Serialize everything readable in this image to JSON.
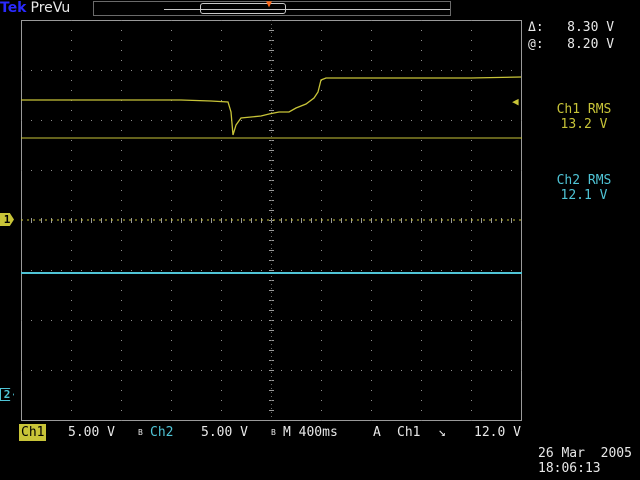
{
  "header": {
    "brand": "Tek",
    "mode": "PreVu"
  },
  "cursors": {
    "delta_label": "Δ:",
    "delta_value": "8.30 V",
    "at_label": "@:",
    "at_value": "8.20 V"
  },
  "measurements": [
    {
      "name": "Ch1 RMS",
      "value": "13.2 V"
    },
    {
      "name": "Ch2 RMS",
      "value": "12.1 V"
    }
  ],
  "channel_markers": {
    "ch1": "1",
    "ch2": "2"
  },
  "status": {
    "ch1_label": "Ch1",
    "ch1_scale": "5.00 V",
    "ch2_label": "Ch2",
    "ch2_scale": "5.00 V",
    "bw_label": "B",
    "timebase": "M 400ms",
    "trigger_prefix": "A",
    "trigger_source": "Ch1",
    "trigger_slope": "↘",
    "trigger_level": "12.0 V"
  },
  "datetime": {
    "date": "26 Mar  2005",
    "time": "18:06:13"
  },
  "colors": {
    "ch1": "#c8c438",
    "ch2": "#4fc4d6",
    "trigger": "#ff6a1a",
    "brand": "#2a2aff"
  },
  "icons": {
    "trigger_position": "triangle-down-icon",
    "trigger_level": "arrow-left-icon"
  }
}
